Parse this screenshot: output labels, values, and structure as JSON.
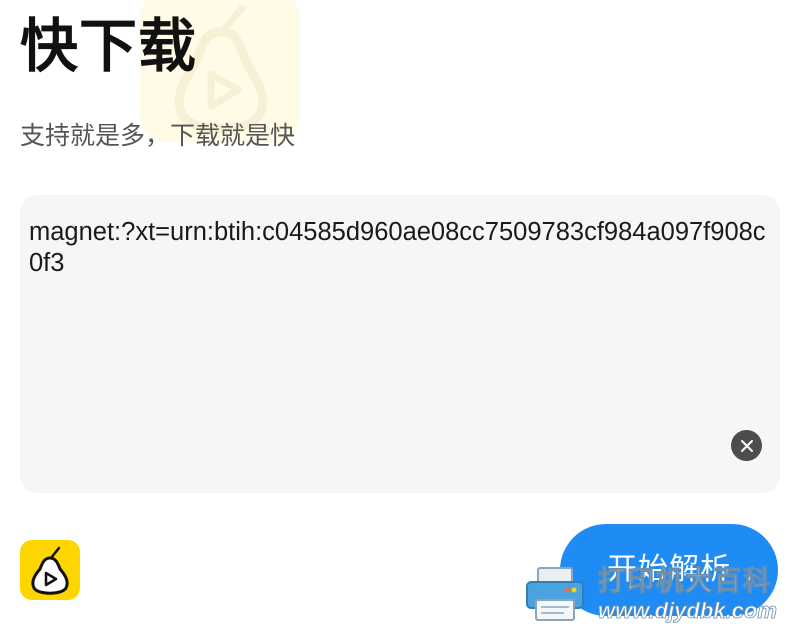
{
  "header": {
    "title": "快下载",
    "subtitle": "支持就是多，下载就是快"
  },
  "input": {
    "value": "magnet:?xt=urn:btih:c04585d960ae08cc7509783cf984a097f908c0f3"
  },
  "actions": {
    "start_label": "开始解析"
  },
  "icons": {
    "clear": "close-circle-icon",
    "app_logo": "pear-play-logo-icon",
    "watermark_printer": "printer-icon"
  },
  "watermark": {
    "line1": "打印机大百科",
    "line2": "www.djydbk.com"
  },
  "colors": {
    "accent": "#1f8cf5",
    "logo_yellow": "#ffd500",
    "card_bg": "#f5f6f5"
  }
}
